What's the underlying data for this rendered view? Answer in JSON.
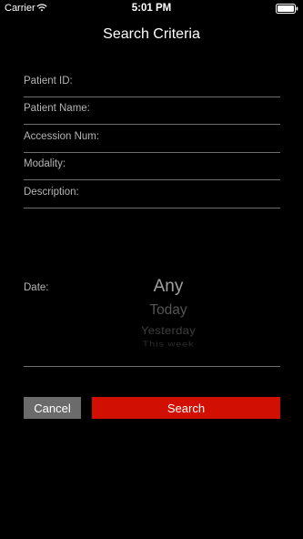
{
  "status_bar": {
    "carrier": "Carrier",
    "time": "5:01 PM",
    "wifi_icon": "wifi-icon",
    "battery_icon": "battery-icon"
  },
  "header": {
    "title": "Search Criteria"
  },
  "form": {
    "fields": [
      {
        "label": "Patient ID:",
        "value": ""
      },
      {
        "label": "Patient Name:",
        "value": ""
      },
      {
        "label": "Accession Num:",
        "value": ""
      },
      {
        "label": "Modality:",
        "value": ""
      },
      {
        "label": "Description:",
        "value": ""
      }
    ],
    "date": {
      "label": "Date:",
      "selected": "Any",
      "options": [
        "Any",
        "Today",
        "Yesterday",
        "This week"
      ]
    }
  },
  "actions": {
    "cancel_label": "Cancel",
    "search_label": "Search"
  },
  "colors": {
    "background": "#000000",
    "search_button": "#d10f02",
    "cancel_button": "#6b6b6b",
    "divider": "#6e6e6e"
  }
}
